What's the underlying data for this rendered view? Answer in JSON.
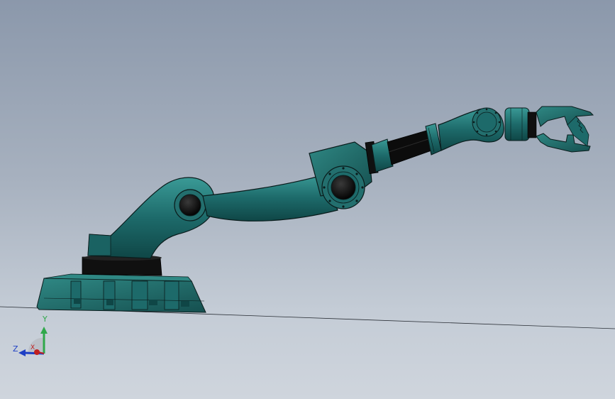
{
  "viewport": {
    "background_top": "#8b98ab",
    "background_bottom": "#cfd5dd"
  },
  "model": {
    "body_color": "#1d6a6a",
    "body_highlight": "#3a9a96",
    "body_shadow": "#0f4646",
    "edge_color": "#0a1c1c",
    "rubber_color": "#101010"
  },
  "triad": {
    "y_label": "Y",
    "z_label": "Z",
    "x_label": "X",
    "y_color": "#2fa84a",
    "z_color": "#1e3fc4",
    "x_color": "#c02020"
  }
}
